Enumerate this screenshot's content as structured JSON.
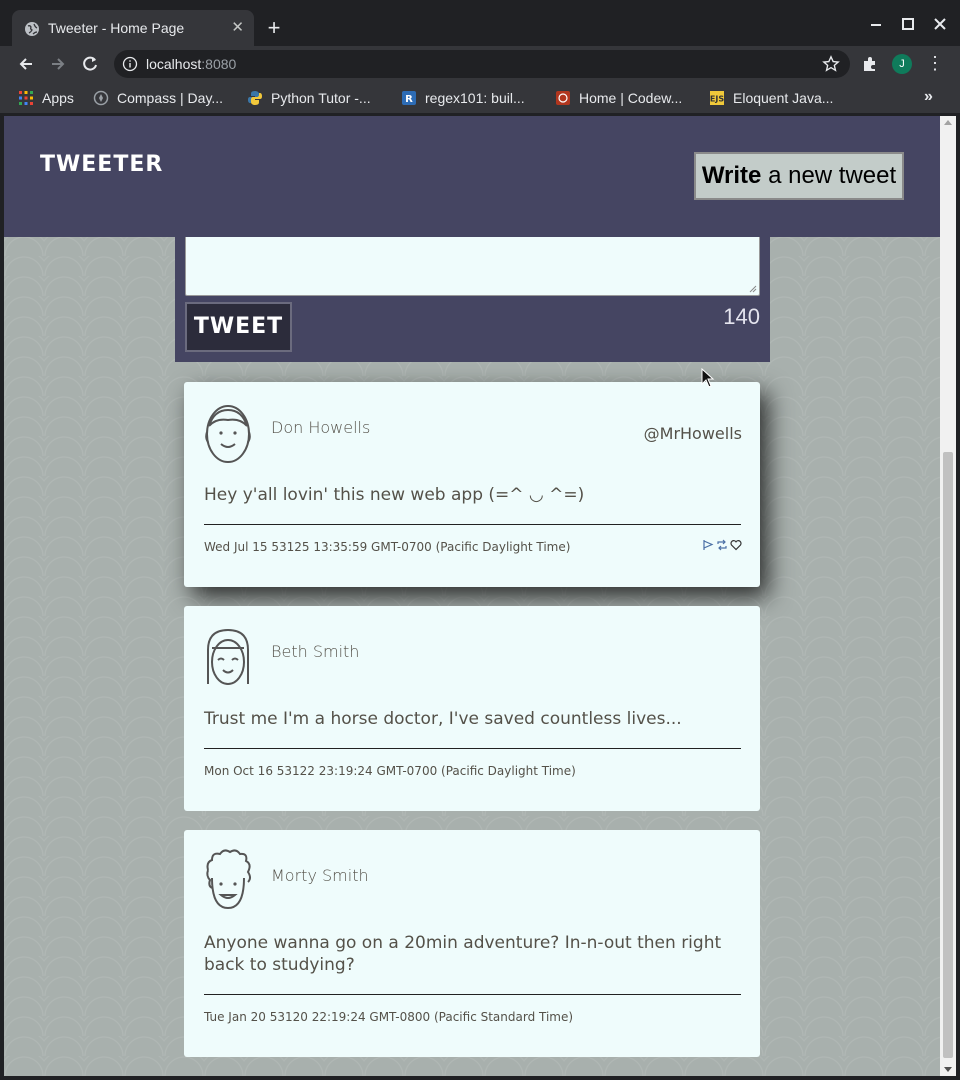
{
  "browser": {
    "tab_title": "Tweeter - Home Page",
    "url_host": "localhost",
    "url_port": ":8080",
    "profile_initial": "J",
    "bookmarks": [
      {
        "label": "Apps",
        "icon": "apps-grid-icon"
      },
      {
        "label": "Compass | Day...",
        "icon": "compass-icon"
      },
      {
        "label": "Python Tutor -...",
        "icon": "python-icon"
      },
      {
        "label": "regex101: buil...",
        "icon": "regex101-icon"
      },
      {
        "label": "Home | Codew...",
        "icon": "codewars-icon"
      },
      {
        "label": "Eloquent Java...",
        "icon": "ejs-icon"
      }
    ],
    "more_bookmarks": "»"
  },
  "header": {
    "brand": "TWEETER",
    "write_bold": "Write",
    "write_rest": " a new tweet"
  },
  "compose": {
    "button_label": "TWEET",
    "counter": "140"
  },
  "tweets": [
    {
      "name": "Don Howells",
      "handle": "@MrHowells",
      "content": "Hey y'all lovin' this new web app (=^ ◡ ^=)",
      "date": "Wed Jul 15 53125 13:35:59 GMT-0700 (Pacific Daylight Time)",
      "avatar": "man-face-avatar",
      "hovered": true
    },
    {
      "name": "Beth Smith",
      "handle": "",
      "content": "Trust me I'm a horse doctor, I've saved countless lives...",
      "date": "Mon Oct 16 53122 23:19:24 GMT-0700 (Pacific Daylight Time)",
      "avatar": "woman-face-avatar",
      "hovered": false
    },
    {
      "name": "Morty Smith",
      "handle": "",
      "content": "Anyone wanna go on a 20min adventure? In-n-out then right back to studying?",
      "date": "Tue Jan 20 53120 22:19:24 GMT-0800 (Pacific Standard Time)",
      "avatar": "curly-hair-avatar",
      "hovered": false
    }
  ],
  "colors": {
    "header_bg": "#454562",
    "card_bg": "#effcfc",
    "text": "#545149",
    "page_bg": "#a8b0ad"
  }
}
